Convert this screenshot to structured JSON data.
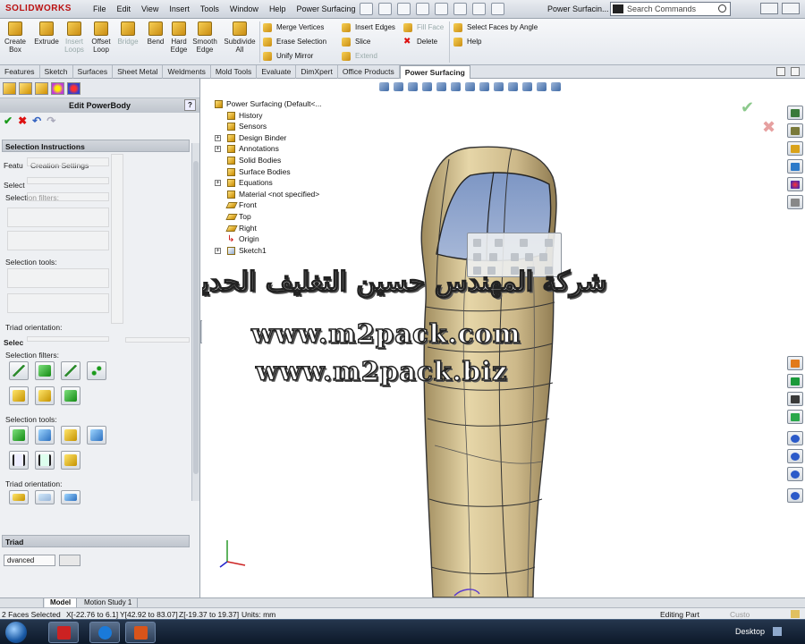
{
  "app": {
    "brand": "SOLIDWORKS",
    "menu": [
      "File",
      "Edit",
      "View",
      "Insert",
      "Tools",
      "Window",
      "Help",
      "Power Surfacing"
    ],
    "doc_title": "Power Surfacin...",
    "search_placeholder": "Search Commands"
  },
  "command_manager": {
    "big_buttons": [
      "Create Box",
      "Extrude",
      "Insert Loops",
      "Offset Loop",
      "Bridge",
      "Bend",
      "Hard Edge",
      "Smooth Edge",
      "Subdivide All"
    ],
    "column1": [
      "Merge Vertices",
      "Erase Selection",
      "Unify Mirror"
    ],
    "column2": [
      "Insert Edges",
      "Slice",
      "Extend"
    ],
    "column3": [
      "Fill Face",
      "Delete"
    ],
    "column4": [
      "Select Faces by Angle",
      "Help"
    ]
  },
  "tabs": [
    "Features",
    "Sketch",
    "Surfaces",
    "Sheet Metal",
    "Weldments",
    "Mold Tools",
    "Evaluate",
    "DimXpert",
    "Office Products",
    "Power Surfacing"
  ],
  "active_tab": "Power Surfacing",
  "property_manager": {
    "title": "Edit PowerBody",
    "help": "?",
    "selection_instructions": "Selection Instructions",
    "ghost": {
      "featu": "Featu",
      "creation_settings": "Creation Settings",
      "select": "Select",
      "selection_filters": "Selection filters:",
      "selection_tools": "Selection tools:",
      "triad_orientation": "Triad orientation:",
      "selec2": "Selec"
    },
    "selection_filters_label": "Selection filters:",
    "selection_tools_label": "Selection tools:",
    "triad_orientation_label": "Triad orientation:",
    "triad_group": "Triad",
    "advanced": "dvanced"
  },
  "tree": {
    "root": "Power Surfacing  (Default<...",
    "items": [
      "History",
      "Sensors",
      "Design Binder",
      "Annotations",
      "Solid Bodies",
      "Surface Bodies",
      "Equations",
      "Material <not specified>",
      "Front",
      "Top",
      "Right",
      "Origin",
      "Sketch1"
    ]
  },
  "watermark": {
    "arabic": "شركة المهندس حسين التغليف الحديث",
    "url1": "www.m2pack.com",
    "url2": "www.m2pack.biz"
  },
  "bottom_tabs": [
    "Model",
    "Motion Study 1"
  ],
  "status": {
    "selected": "2 Faces Selected",
    "x": "X[-22.76 to 6.1]",
    "y": "Y[42.92 to 83.07]",
    "z": "Z[-19.37 to 19.37]",
    "units": "Units: mm",
    "mode": "Editing Part",
    "custom": "Custo"
  },
  "taskbar": {
    "desktop": "Desktop"
  },
  "colors": {
    "body_fill": "#cdb98a",
    "selected_face": "#8fa6cf",
    "brand_red": "#b11111",
    "accent_blue": "#3a6fc1"
  }
}
